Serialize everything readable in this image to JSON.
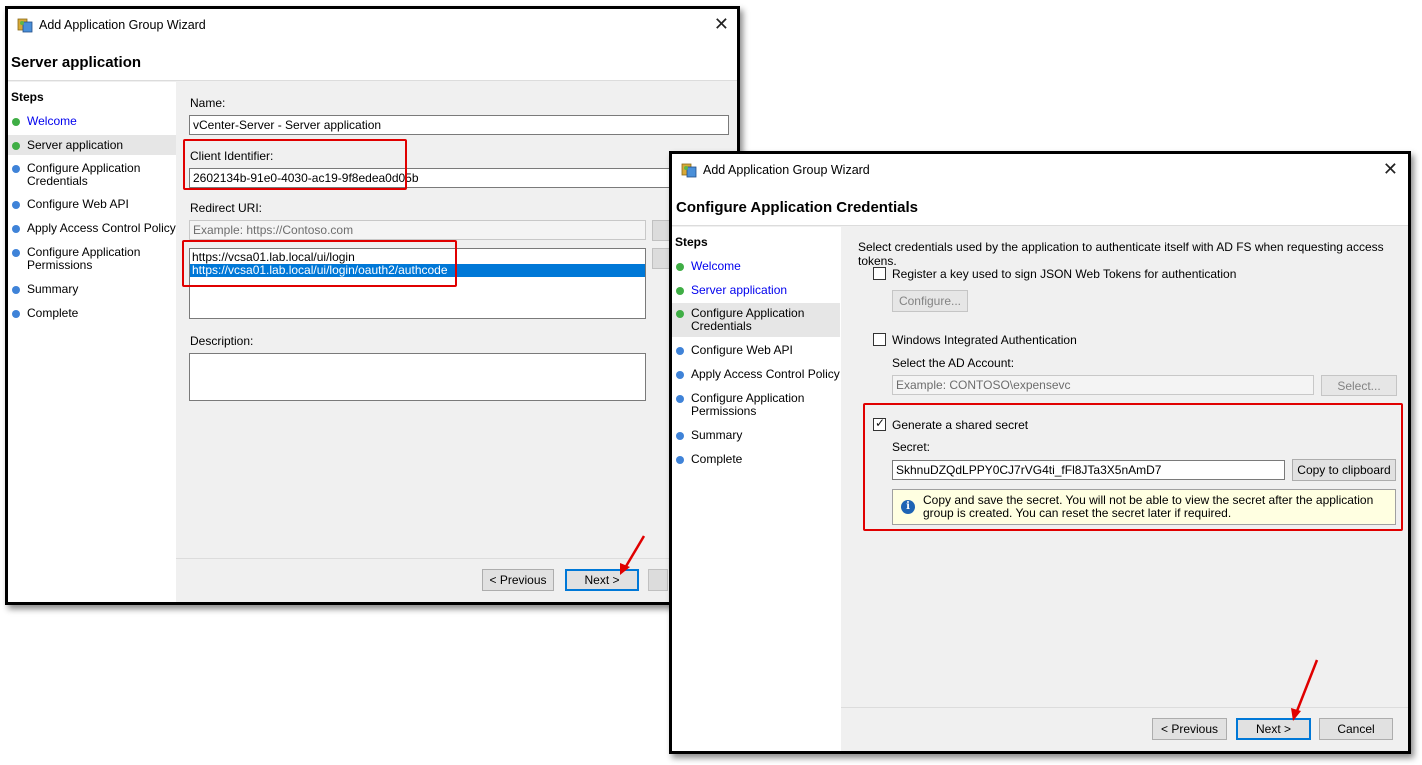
{
  "window1": {
    "title": "Add Application Group Wizard",
    "page_title": "Server application",
    "close": "✕",
    "steps_title": "Steps",
    "steps": [
      {
        "label": "Welcome"
      },
      {
        "label": "Server application"
      },
      {
        "label": "Configure Application Credentials"
      },
      {
        "label": "Configure Web API"
      },
      {
        "label": "Apply Access Control Policy"
      },
      {
        "label": "Configure Application Permissions"
      },
      {
        "label": "Summary"
      },
      {
        "label": "Complete"
      }
    ],
    "name_label": "Name:",
    "name_value": "vCenter-Server - Server application",
    "client_id_label": "Client Identifier:",
    "client_id_value": "2602134b-91e0-4030-ac19-9f8edea0d05b",
    "redirect_label": "Redirect URI:",
    "redirect_placeholder": "Example: https://Contoso.com",
    "redirect_uris": [
      "https://vcsa01.lab.local/ui/login",
      "https://vcsa01.lab.local/ui/login/oauth2/authcode"
    ],
    "description_label": "Description:",
    "description_value": "",
    "prev_button": "< Previous",
    "next_button": "Next >"
  },
  "window2": {
    "title": "Add Application Group Wizard",
    "page_title": "Configure Application Credentials",
    "close": "✕",
    "steps_title": "Steps",
    "steps": [
      {
        "label": "Welcome"
      },
      {
        "label": "Server application"
      },
      {
        "label": "Configure Application Credentials"
      },
      {
        "label": "Configure Web API"
      },
      {
        "label": "Apply Access Control Policy"
      },
      {
        "label": "Configure Application Permissions"
      },
      {
        "label": "Summary"
      },
      {
        "label": "Complete"
      }
    ],
    "intro": "Select credentials used by the application to authenticate itself with AD FS when requesting access tokens.",
    "jwt_label": "Register a key used to sign JSON Web Tokens for authentication",
    "jwt_checked": false,
    "configure_button": "Configure...",
    "wia_label": "Windows Integrated Authentication",
    "wia_checked": false,
    "ad_account_label": "Select the AD Account:",
    "ad_account_placeholder": "Example: CONTOSO\\expensevc",
    "select_button": "Select...",
    "shared_secret_label": "Generate a shared secret",
    "shared_secret_checked": true,
    "check_mark": "✓",
    "secret_label": "Secret:",
    "secret_value": "SkhnuDZQdLPPY0CJ7rVG4ti_fFl8JTa3X5nAmD7",
    "copy_button": "Copy to clipboard",
    "info_icon": "i",
    "info_text": "Copy and save the secret.  You will not be able to view the secret after the application group is created.  You can reset the secret later if required.",
    "prev_button": "< Previous",
    "next_button": "Next >",
    "cancel_button": "Cancel"
  },
  "colors": {
    "highlight_red": "#e00000",
    "selection_blue": "#0078d7",
    "link_blue": "#0000ee",
    "step_done_green": "#3fae45",
    "step_todo_blue": "#3f83d8"
  }
}
